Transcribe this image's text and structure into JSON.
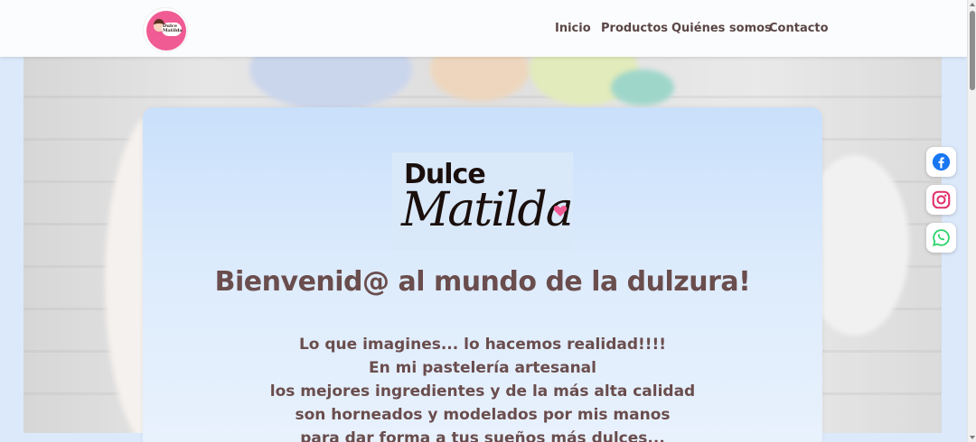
{
  "header": {
    "logo_text": "Dulce Matilda",
    "nav": [
      {
        "label": "Inicio"
      },
      {
        "label": "Productos"
      },
      {
        "label": "Quiénes somos"
      },
      {
        "label": "Contacto"
      }
    ]
  },
  "social": [
    {
      "icon": "facebook-icon",
      "color": "#1877f2"
    },
    {
      "icon": "instagram-icon",
      "color": "#e1306c"
    },
    {
      "icon": "whatsapp-icon",
      "color": "#25d366"
    }
  ],
  "brand": {
    "top": "Dulce",
    "main": "Matilda"
  },
  "hero": {
    "headline": "Bienvenid@ al mundo de la dulzura!",
    "lines": [
      "Lo que imagines... lo hacemos realidad!!!!",
      "En mi pastelería artesanal",
      "los mejores ingredientes y de la más alta calidad",
      "son horneados y modelados por mis manos",
      "para dar forma a tus sueños más dulces..."
    ]
  },
  "colors": {
    "accent_pink": "#f05b94",
    "text_brown": "#6a4d4d",
    "nav_text": "#5b4646",
    "card_bg": "#c9e0fb"
  }
}
